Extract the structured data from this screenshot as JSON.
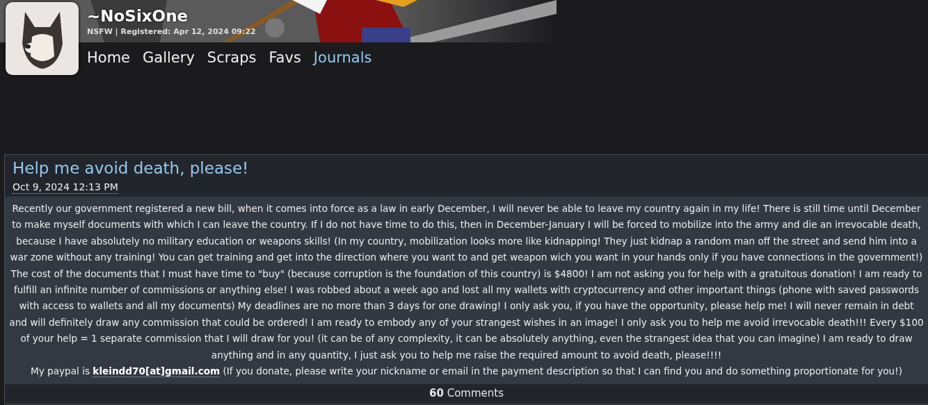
{
  "profile": {
    "username": "~NoSixOne",
    "meta": "NSFW | Registered: Apr 12, 2024 09:22"
  },
  "nav": [
    {
      "label": "Home",
      "selected": false
    },
    {
      "label": "Gallery",
      "selected": false
    },
    {
      "label": "Scraps",
      "selected": false
    },
    {
      "label": "Favs",
      "selected": false
    },
    {
      "label": "Journals",
      "selected": true
    }
  ],
  "journal": {
    "title": "Help me avoid death, please!",
    "date": "Oct 9, 2024 12:13 PM",
    "body": "Recently our government registered a new bill, when it comes into force as a law in early December, I will never be able to leave my country again in my life! There is still time until December to make myself documents with which I can leave the country. If I do not have time to do this, then in December-January I will be forced to mobilize into the army and die an irrevocable death, because I have absolutely no military education or weapons skills! (In my country, mobilization looks more like kidnapping! They just kidnap a random man off the street and send him into a war zone without any training! You can get training and get into the direction where you want to and get weapon wich you want in your hands only if you have connections in the government!) The cost of the documents that I must have time to \"buy\" (because corruption is the foundation of this country) is $4800! I am not asking you for help with a gratuitous donation! I am ready to fulfill an infinite number of commissions or anything else! I was robbed about a week ago and lost all my wallets with cryptocurrency and other important things (phone with saved passwords with access to wallets and all my documents) My deadlines are no more than 3 days for one drawing! I only ask you, if you have the opportunity, please help me! I will never remain in debt and will definitely draw any commission that could be ordered! I am ready to embody any of your strangest wishes in an image! I only ask you to help me avoid irrevocable death!!! Every $100 of your help = 1 separate commission that I will draw for you! (it can be of any complexity, it can be absolutely anything, even the strangest idea that you can imagine) I am ready to draw anything and in any quantity, I just ask you to help me raise the required amount to avoid death, please!!!!",
    "paypal_prefix": "My paypal is",
    "paypal_email": "kleindd70[at]gmail.com",
    "paypal_suffix": "(If you donate, please write your nickname or email in the payment description so that I can find you and do something proportionate for you!)",
    "comments": "**60** Comments"
  }
}
